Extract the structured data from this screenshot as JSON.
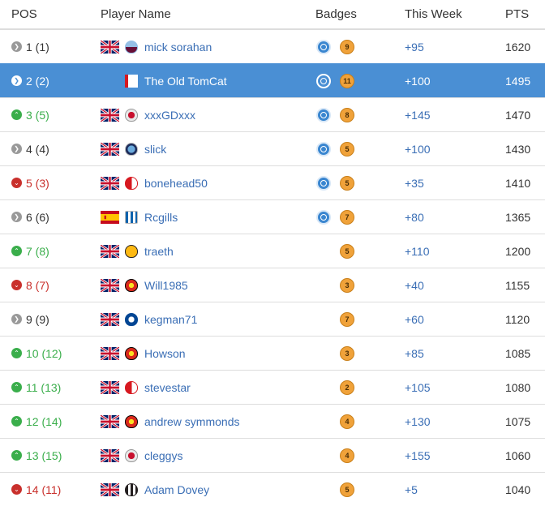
{
  "headers": {
    "pos": "POS",
    "player": "Player Name",
    "badges": "Badges",
    "week": "This Week",
    "pts": "PTS"
  },
  "colors": {
    "highlight": "#4a8fd4",
    "up": "#3aae4b",
    "down": "#c9302c",
    "same": "#999999",
    "link": "#3a6eb5",
    "coin": "#f0a23a",
    "target": "#3a86d0"
  },
  "rows": [
    {
      "pos": "1 (1)",
      "trend": "same",
      "flag": "gb",
      "club": "aston-villa",
      "name": "mick sorahan",
      "target": true,
      "coin": "9",
      "week": "+95",
      "pts": "1620",
      "highlight": false
    },
    {
      "pos": "2 (2)",
      "trend": "same",
      "flag": "",
      "club": "bournemouth",
      "name": "The Old TomCat",
      "target": true,
      "coin": "11",
      "week": "+100",
      "pts": "1495",
      "highlight": true
    },
    {
      "pos": "3 (5)",
      "trend": "up",
      "flag": "gb",
      "club": "liverpool",
      "name": "xxxGDxxx",
      "target": true,
      "coin": "8",
      "week": "+145",
      "pts": "1470",
      "highlight": false
    },
    {
      "pos": "4 (4)",
      "trend": "same",
      "flag": "gb",
      "club": "man-city",
      "name": "slick",
      "target": true,
      "coin": "5",
      "week": "+100",
      "pts": "1430",
      "highlight": false
    },
    {
      "pos": "5 (3)",
      "trend": "down",
      "flag": "gb",
      "club": "southampton",
      "name": "bonehead50",
      "target": true,
      "coin": "5",
      "week": "+35",
      "pts": "1410",
      "highlight": false
    },
    {
      "pos": "6 (6)",
      "trend": "same",
      "flag": "es",
      "club": "huddersfield",
      "name": "Rcgills",
      "target": true,
      "coin": "7",
      "week": "+80",
      "pts": "1365",
      "highlight": false
    },
    {
      "pos": "7 (8)",
      "trend": "up",
      "flag": "gb",
      "club": "wolves",
      "name": "traeth",
      "target": false,
      "coin": "5",
      "week": "+110",
      "pts": "1200",
      "highlight": false
    },
    {
      "pos": "8 (7)",
      "trend": "down",
      "flag": "gb",
      "club": "man-utd",
      "name": "Will1985",
      "target": false,
      "coin": "3",
      "week": "+40",
      "pts": "1155",
      "highlight": false
    },
    {
      "pos": "9 (9)",
      "trend": "same",
      "flag": "gb",
      "club": "chelsea",
      "name": "kegman71",
      "target": false,
      "coin": "7",
      "week": "+60",
      "pts": "1120",
      "highlight": false
    },
    {
      "pos": "10 (12)",
      "trend": "up",
      "flag": "gb",
      "club": "man-utd",
      "name": "Howson",
      "target": false,
      "coin": "3",
      "week": "+85",
      "pts": "1085",
      "highlight": false
    },
    {
      "pos": "11 (13)",
      "trend": "up",
      "flag": "gb",
      "club": "southampton",
      "name": "stevestar",
      "target": false,
      "coin": "2",
      "week": "+105",
      "pts": "1080",
      "highlight": false
    },
    {
      "pos": "12 (14)",
      "trend": "up",
      "flag": "gb",
      "club": "man-utd",
      "name": "andrew symmonds",
      "target": false,
      "coin": "4",
      "week": "+130",
      "pts": "1075",
      "highlight": false
    },
    {
      "pos": "13 (15)",
      "trend": "up",
      "flag": "gb",
      "club": "liverpool",
      "name": "cleggys",
      "target": false,
      "coin": "4",
      "week": "+155",
      "pts": "1060",
      "highlight": false
    },
    {
      "pos": "14 (11)",
      "trend": "down",
      "flag": "gb",
      "club": "newcastle",
      "name": "Adam Dovey",
      "target": false,
      "coin": "5",
      "week": "+5",
      "pts": "1040",
      "highlight": false
    }
  ]
}
